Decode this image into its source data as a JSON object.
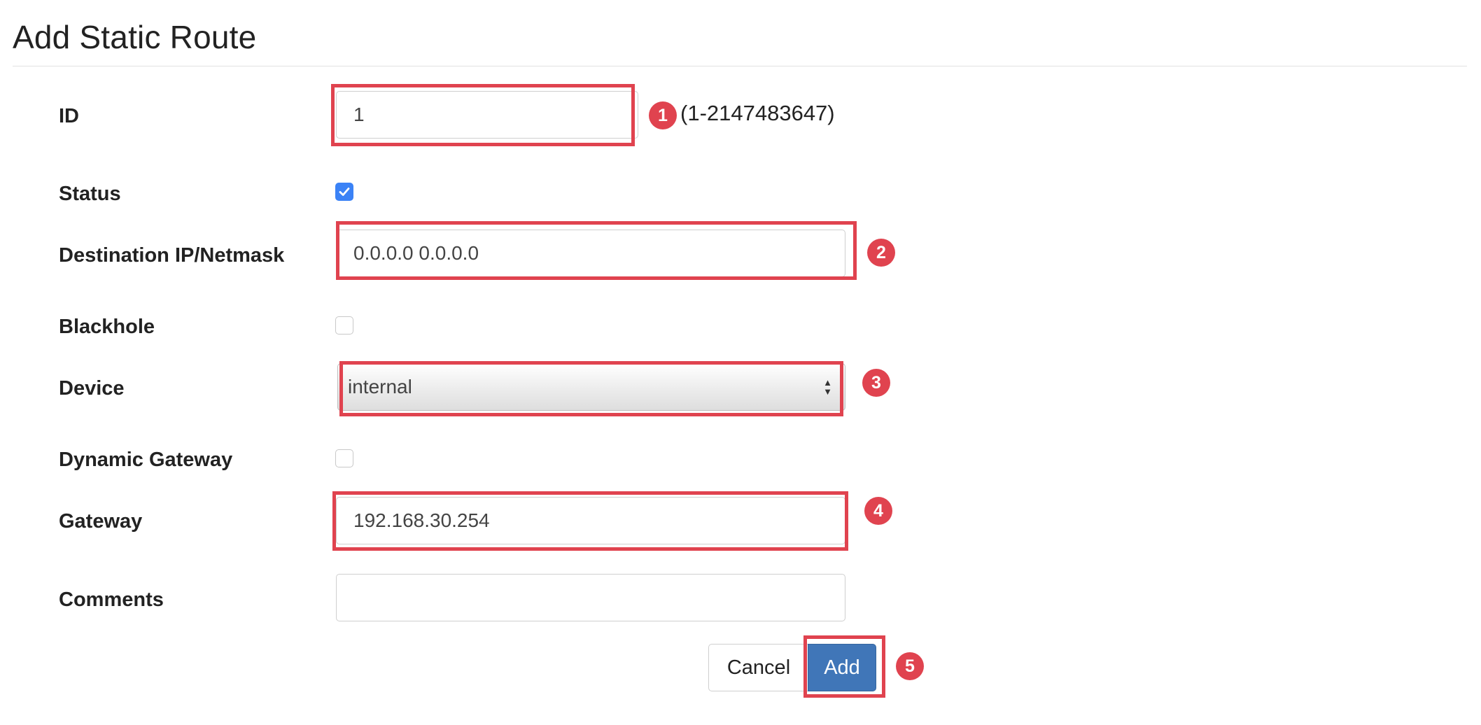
{
  "page": {
    "title": "Add Static Route"
  },
  "fields": {
    "id": {
      "label": "ID",
      "value": "1",
      "hint": "(1-2147483647)"
    },
    "status": {
      "label": "Status",
      "checked": true
    },
    "destination": {
      "label": "Destination IP/Netmask",
      "value": "0.0.0.0 0.0.0.0"
    },
    "blackhole": {
      "label": "Blackhole",
      "checked": false
    },
    "device": {
      "label": "Device",
      "value": "internal"
    },
    "dynamic_gateway": {
      "label": "Dynamic Gateway",
      "checked": false
    },
    "gateway": {
      "label": "Gateway",
      "value": "192.168.30.254"
    },
    "comments": {
      "label": "Comments",
      "value": ""
    }
  },
  "buttons": {
    "cancel": "Cancel",
    "add": "Add"
  },
  "annotations": [
    "1",
    "2",
    "3",
    "4",
    "5"
  ],
  "colors": {
    "highlight": "#e0434f",
    "primary": "#4076b8",
    "checkbox": "#3b82f6"
  }
}
